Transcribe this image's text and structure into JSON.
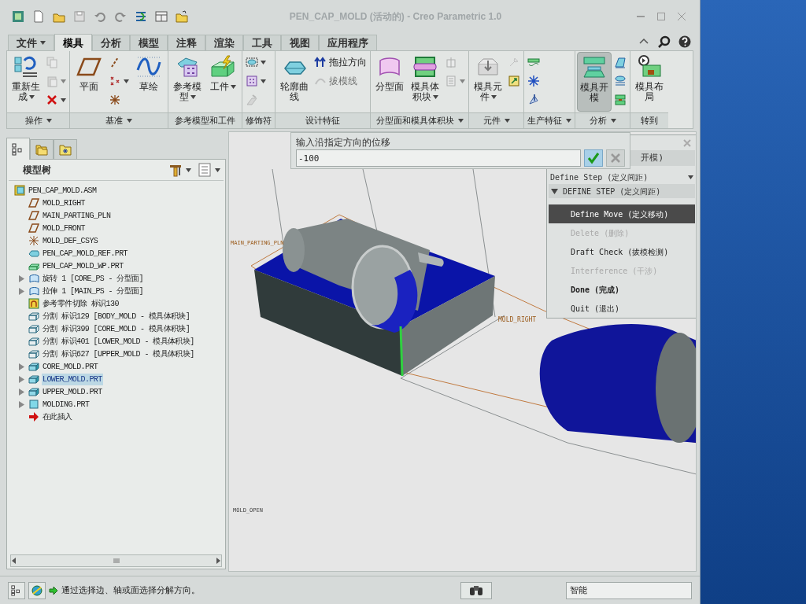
{
  "window": {
    "title": "PEN_CAP_MOLD (活动的) - Creo Parametric 1.0"
  },
  "tabs": [
    {
      "label": "文件",
      "kind": "menu",
      "selected": false
    },
    {
      "label": "模具",
      "kind": "tab",
      "selected": true
    },
    {
      "label": "分析",
      "kind": "tab",
      "selected": false
    },
    {
      "label": "模型",
      "kind": "tab",
      "selected": false
    },
    {
      "label": "注释",
      "kind": "tab",
      "selected": false
    },
    {
      "label": "渲染",
      "kind": "tab",
      "selected": false
    },
    {
      "label": "工具",
      "kind": "tab",
      "selected": false
    },
    {
      "label": "视图",
      "kind": "tab",
      "selected": false
    },
    {
      "label": "应用程序",
      "kind": "tab",
      "selected": false
    }
  ],
  "ribbon_groups": [
    {
      "label": "操作",
      "has_menu": true,
      "buttons": [
        {
          "kind": "large",
          "label": "重新生成",
          "has_menu": true,
          "pressed": false,
          "disabled": false
        },
        {
          "kind": "small",
          "has_menu": false,
          "pressed": false,
          "disabled": true
        },
        {
          "kind": "small",
          "has_menu": true,
          "pressed": false,
          "disabled": true
        },
        {
          "kind": "small",
          "has_menu": true,
          "pressed": false,
          "disabled": false
        }
      ]
    },
    {
      "label": "基准",
      "has_menu": true,
      "buttons": [
        {
          "kind": "large",
          "label": "平面",
          "has_menu": false,
          "pressed": false,
          "disabled": false
        },
        {
          "kind": "small",
          "has_menu": false,
          "pressed": false,
          "disabled": false
        },
        {
          "kind": "small",
          "has_menu": true,
          "pressed": false,
          "disabled": false
        },
        {
          "kind": "small",
          "has_menu": false,
          "pressed": false,
          "disabled": false
        },
        {
          "kind": "large",
          "label": "草绘",
          "has_menu": false,
          "pressed": false,
          "disabled": false
        }
      ]
    },
    {
      "label": "参考模型和工件",
      "has_menu": false,
      "buttons": [
        {
          "kind": "large",
          "label": "参考模型",
          "has_menu": true,
          "pressed": false,
          "disabled": false
        },
        {
          "kind": "large",
          "label": "工件",
          "has_menu": true,
          "pressed": false,
          "disabled": false
        }
      ]
    },
    {
      "label": "修饰符",
      "has_menu": false,
      "buttons": [
        {
          "kind": "small",
          "has_menu": true,
          "pressed": false,
          "disabled": false
        },
        {
          "kind": "small",
          "has_menu": true,
          "pressed": false,
          "disabled": false
        },
        {
          "kind": "small",
          "has_menu": false,
          "pressed": false,
          "disabled": true
        }
      ]
    },
    {
      "label": "设计特征",
      "has_menu": false,
      "buttons": [
        {
          "kind": "large",
          "label": "轮廓曲线",
          "has_menu": false,
          "pressed": false,
          "disabled": false
        },
        {
          "kind": "small",
          "label": "拖拉方向",
          "has_menu": false,
          "pressed": false,
          "disabled": false
        },
        {
          "kind": "small",
          "label": "拔模线",
          "has_menu": false,
          "pressed": false,
          "disabled": true
        }
      ]
    },
    {
      "label": "分型面和模具体积块",
      "has_menu": true,
      "buttons": [
        {
          "kind": "large",
          "label": "分型面",
          "has_menu": false,
          "pressed": false,
          "disabled": false
        },
        {
          "kind": "large",
          "label": "模具体积块",
          "has_menu": true,
          "pressed": false,
          "disabled": false
        },
        {
          "kind": "small",
          "has_menu": false,
          "pressed": false,
          "disabled": true
        },
        {
          "kind": "small",
          "has_menu": true,
          "pressed": false,
          "disabled": true
        }
      ]
    },
    {
      "label": "元件",
      "has_menu": true,
      "buttons": [
        {
          "kind": "large",
          "label": "模具元件",
          "has_menu": true,
          "pressed": false,
          "disabled": false
        },
        {
          "kind": "small",
          "has_menu": false,
          "pressed": false,
          "disabled": true
        },
        {
          "kind": "small",
          "has_menu": false,
          "pressed": false,
          "disabled": false
        }
      ]
    },
    {
      "label": "生产特征",
      "has_menu": true,
      "buttons": [
        {
          "kind": "small",
          "has_menu": false,
          "pressed": false,
          "disabled": false
        },
        {
          "kind": "small",
          "has_menu": false,
          "pressed": false,
          "disabled": false
        },
        {
          "kind": "small",
          "has_menu": false,
          "pressed": false,
          "disabled": false
        }
      ]
    },
    {
      "label": "分析",
      "has_menu": true,
      "buttons": [
        {
          "kind": "large",
          "label": "模具开模",
          "has_menu": false,
          "pressed": true,
          "disabled": false
        },
        {
          "kind": "small",
          "has_menu": false,
          "pressed": false,
          "disabled": false
        },
        {
          "kind": "small",
          "has_menu": false,
          "pressed": false,
          "disabled": false
        },
        {
          "kind": "small",
          "has_menu": false,
          "pressed": false,
          "disabled": false
        }
      ]
    },
    {
      "label": "转到",
      "has_menu": false,
      "buttons": [
        {
          "kind": "large",
          "label": "模具布局",
          "has_menu": false,
          "pressed": false,
          "disabled": false
        }
      ]
    }
  ],
  "model_tree": {
    "tabs": [
      {
        "kind": "tree",
        "selected": true
      },
      {
        "kind": "folders",
        "selected": false
      },
      {
        "kind": "favorites",
        "selected": false
      }
    ],
    "title": "模型树",
    "items": [
      {
        "kind": "assembly",
        "label": "PEN_CAP_MOLD.ASM",
        "collapsed": false,
        "selected": false,
        "children": [
          {
            "kind": "plane",
            "label": "MOLD_RIGHT",
            "collapsed": false,
            "selected": false
          },
          {
            "kind": "plane",
            "label": "MAIN_PARTING_PLN",
            "collapsed": false,
            "selected": false
          },
          {
            "kind": "plane",
            "label": "MOLD_FRONT",
            "collapsed": false,
            "selected": false
          },
          {
            "kind": "csys",
            "label": "MOLD_DEF_CSYS",
            "collapsed": false,
            "selected": false
          },
          {
            "kind": "refpart",
            "label": "PEN_CAP_MOLD_REF.PRT",
            "collapsed": false,
            "selected": false
          },
          {
            "kind": "workpiece",
            "label": "PEN_CAP_MOLD_WP.PRT",
            "collapsed": false,
            "selected": false
          },
          {
            "kind": "surface",
            "label": "旋转 1 [CORE_PS - 分型面]",
            "collapsed": true,
            "selected": false
          },
          {
            "kind": "surface",
            "label": "拉伸 1 [MAIN_PS - 分型面]",
            "collapsed": true,
            "selected": false
          },
          {
            "kind": "cut",
            "label": "参考零件切除 标识130",
            "collapsed": false,
            "selected": false
          },
          {
            "kind": "split",
            "label": "分割 标识129 [BODY_MOLD - 模具体积块]",
            "collapsed": false,
            "selected": false
          },
          {
            "kind": "split",
            "label": "分割 标识399 [CORE_MOLD - 模具体积块]",
            "collapsed": false,
            "selected": false
          },
          {
            "kind": "split",
            "label": "分割 标识401 [LOWER_MOLD - 模具体积块]",
            "collapsed": false,
            "selected": false
          },
          {
            "kind": "split",
            "label": "分割 标识627 [UPPER_MOLD - 模具体积块]",
            "collapsed": false,
            "selected": false
          },
          {
            "kind": "moldpart",
            "label": "CORE_MOLD.PRT",
            "collapsed": true,
            "selected": false
          },
          {
            "kind": "moldpart",
            "label": "LOWER_MOLD.PRT",
            "collapsed": true,
            "selected": true
          },
          {
            "kind": "moldpart",
            "label": "UPPER_MOLD.PRT",
            "collapsed": true,
            "selected": false
          },
          {
            "kind": "molding",
            "label": "MOLDING.PRT",
            "collapsed": true,
            "selected": false
          },
          {
            "kind": "insert",
            "label": "在此插入",
            "collapsed": false,
            "selected": false
          }
        ]
      }
    ]
  },
  "prompt_dialog": {
    "prompt": "输入沿指定方向的位移",
    "value": "-100"
  },
  "menu_manager": {
    "top_item": "开模)",
    "dropdown": "Define Step (定义间距)",
    "section": {
      "label": "DEFINE STEP (定义间距)",
      "expanded": true
    },
    "items": [
      {
        "label": "Define Move (定义移动)",
        "kind": "normal",
        "selected": true,
        "disabled": false
      },
      {
        "label": "Delete (删除)",
        "kind": "normal",
        "selected": false,
        "disabled": true
      },
      {
        "label": "Draft Check (拔模检测)",
        "kind": "normal",
        "selected": false,
        "disabled": false
      },
      {
        "label": "Interference (干涉)",
        "kind": "normal",
        "selected": false,
        "disabled": true
      },
      {
        "label": "Done (完成)",
        "kind": "emphasis",
        "selected": false,
        "disabled": false
      },
      {
        "label": "Quit (退出)",
        "kind": "normal",
        "selected": false,
        "disabled": false
      }
    ]
  },
  "graphics": {
    "labels": [
      "MAIN_PARTING_PLN",
      "MOLD_RIGHT",
      "MOLD_OPEN"
    ]
  },
  "status_bar": {
    "message": "通过选择边、轴或面选择分解方向。",
    "filter": "智能"
  }
}
